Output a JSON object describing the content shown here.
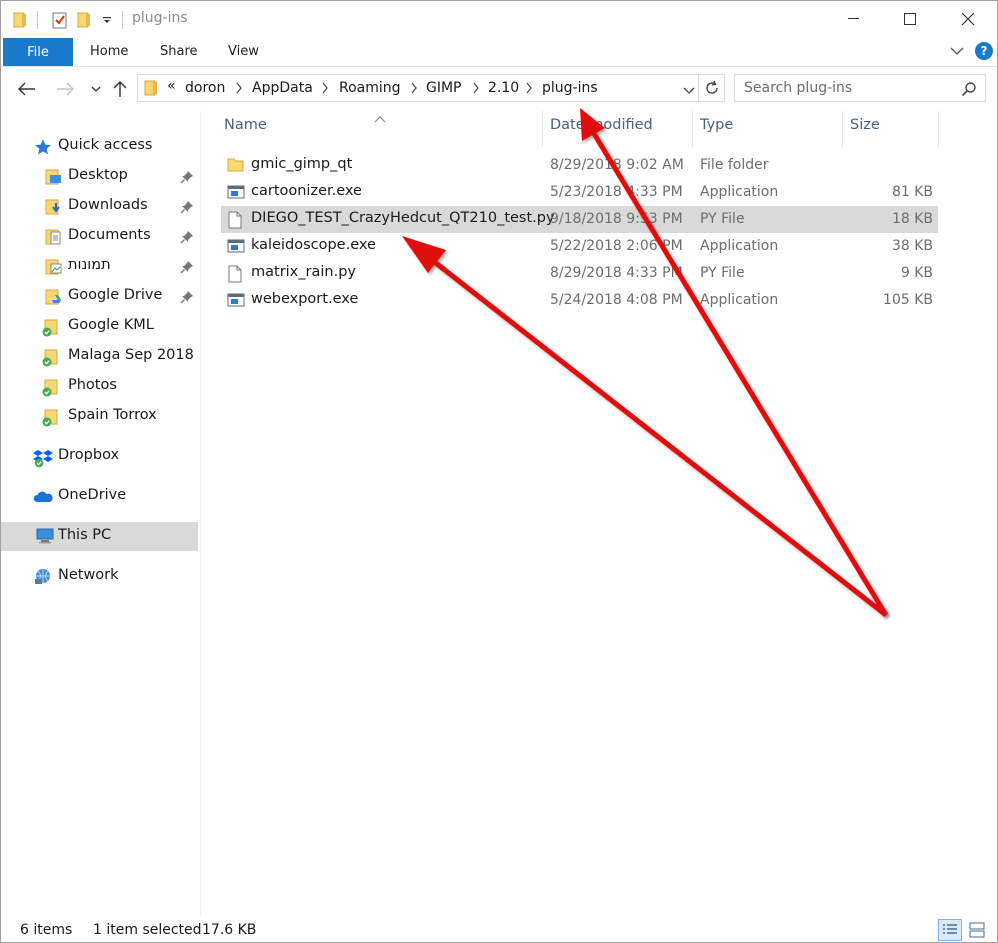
{
  "window": {
    "title": "plug-ins"
  },
  "ribbon": {
    "file_label": "File",
    "tabs": [
      "Home",
      "Share",
      "View"
    ]
  },
  "address": {
    "overflow": "«",
    "crumbs": [
      "doron",
      "AppData",
      "Roaming",
      "GIMP",
      "2.10",
      "plug-ins"
    ]
  },
  "search": {
    "placeholder": "Search plug-ins"
  },
  "nav": {
    "quick_access": "Quick access",
    "items": [
      {
        "label": "Desktop",
        "pinned": true,
        "icon": "desktop-folder-icon"
      },
      {
        "label": "Downloads",
        "pinned": true,
        "icon": "downloads-folder-icon"
      },
      {
        "label": "Documents",
        "pinned": true,
        "icon": "documents-folder-icon"
      },
      {
        "label": "תמונות",
        "pinned": true,
        "icon": "pictures-folder-icon"
      },
      {
        "label": "Google Drive",
        "pinned": true,
        "icon": "google-drive-folder-icon"
      },
      {
        "label": "Google KML",
        "pinned": false,
        "icon": "synced-folder-icon"
      },
      {
        "label": "Malaga Sep 2018",
        "pinned": false,
        "icon": "synced-folder-icon"
      },
      {
        "label": "Photos",
        "pinned": false,
        "icon": "synced-folder-icon"
      },
      {
        "label": "Spain Torrox",
        "pinned": false,
        "icon": "synced-folder-icon"
      }
    ],
    "dropbox": "Dropbox",
    "onedrive": "OneDrive",
    "this_pc": "This PC",
    "network": "Network"
  },
  "columns": {
    "name": "Name",
    "date": "Date modified",
    "type": "Type",
    "size": "Size"
  },
  "files": [
    {
      "name": "gmic_gimp_qt",
      "date": "8/29/2018 9:02 AM",
      "type": "File folder",
      "size": "",
      "icon": "folder-icon"
    },
    {
      "name": "cartoonizer.exe",
      "date": "5/23/2018 4:33 PM",
      "type": "Application",
      "size": "81 KB",
      "icon": "application-icon"
    },
    {
      "name": "DIEGO_TEST_CrazyHedcut_QT210_test.py",
      "date": "9/18/2018 9:53 PM",
      "type": "PY File",
      "size": "18 KB",
      "icon": "file-icon",
      "selected": true
    },
    {
      "name": "kaleidoscope.exe",
      "date": "5/22/2018 2:06 PM",
      "type": "Application",
      "size": "38 KB",
      "icon": "application-icon"
    },
    {
      "name": "matrix_rain.py",
      "date": "8/29/2018 4:33 PM",
      "type": "PY File",
      "size": "9 KB",
      "icon": "file-icon"
    },
    {
      "name": "webexport.exe",
      "date": "5/24/2018 4:08 PM",
      "type": "Application",
      "size": "105 KB",
      "icon": "application-icon"
    }
  ],
  "status": {
    "items": "6 items",
    "selected": "1 item selected",
    "size": "17.6 KB"
  },
  "colors": {
    "accent": "#1979ca",
    "selection": "#d9d9d9",
    "folder": "#f8d775",
    "annotation_arrow": "#e01010"
  }
}
